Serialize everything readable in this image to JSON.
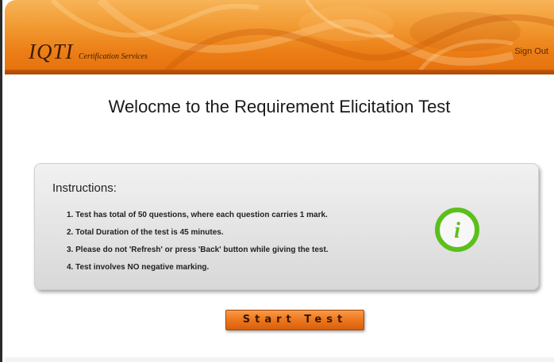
{
  "header": {
    "brand_main": "IQTI",
    "brand_sub": "Certification Services",
    "signout_label": "Sign Out"
  },
  "main": {
    "title": "Welocme to the Requirement Elicitation Test"
  },
  "instructions": {
    "heading": "Instructions:",
    "items": [
      "1. Test has total of 50 questions,  where each question carries 1 mark.",
      "2. Total Duration of the test is 45 minutes.",
      "3. Please do not 'Refresh' or press 'Back'  button while giving the test.",
      "4. Test involves NO negative marking."
    ],
    "info_glyph": "i",
    "info_icon": "info-icon"
  },
  "actions": {
    "start_label": "Start Test"
  },
  "colors": {
    "accent": "#ec7e16",
    "info_green": "#5cbf1c"
  }
}
